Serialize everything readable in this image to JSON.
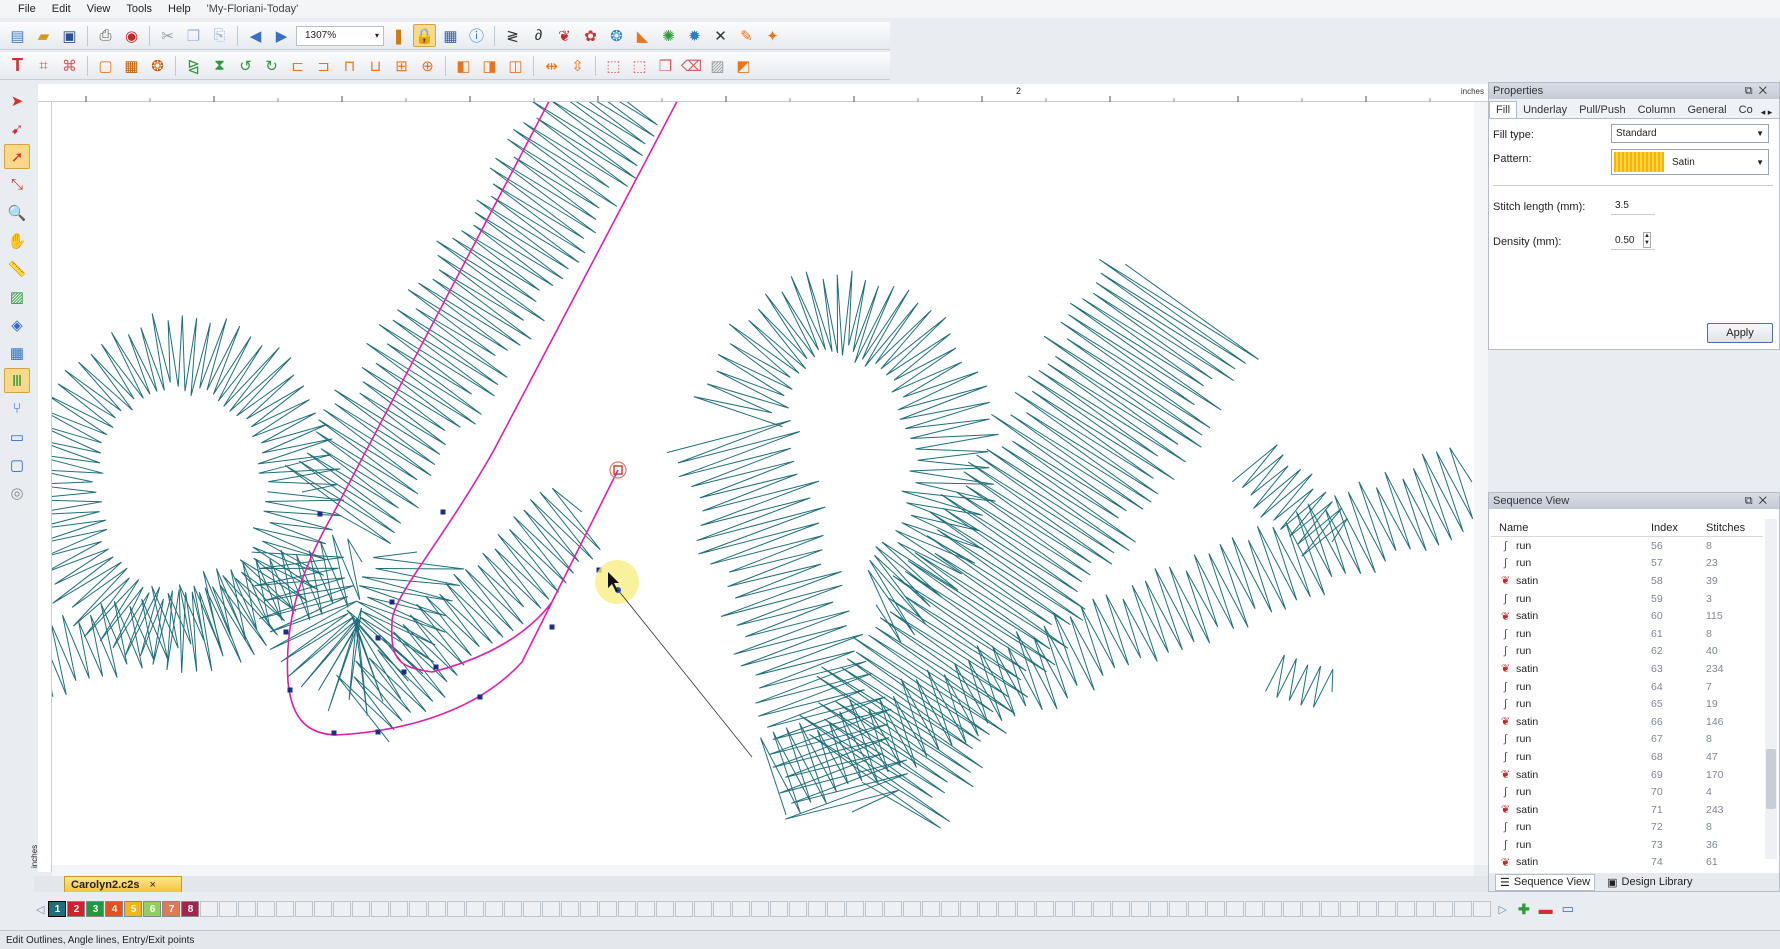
{
  "menu": {
    "items": [
      "File",
      "Edit",
      "View",
      "Tools",
      "Help"
    ],
    "title": "'My-Floriani-Today'"
  },
  "toolbar": {
    "zoom_value": "1307%"
  },
  "ruler": {
    "unit_top": "inches",
    "unit_left": "inches",
    "label_2": "2"
  },
  "document": {
    "tab_name": "Carolyn2.c2s",
    "close_symbol": "×"
  },
  "properties": {
    "title": "Properties",
    "tabs": [
      "Fill",
      "Underlay",
      "Pull/Push",
      "Column",
      "General",
      "Co"
    ],
    "fill_type_label": "Fill type:",
    "fill_type_value": "Standard",
    "pattern_label": "Pattern:",
    "pattern_value": "Satin",
    "stitch_length_label": "Stitch length (mm):",
    "stitch_length_value": "3.5",
    "density_label": "Density (mm):",
    "density_value": "0.50",
    "apply_label": "Apply"
  },
  "sequence": {
    "title": "Sequence View",
    "headers": [
      "Name",
      "Index",
      "Stitches"
    ],
    "rows": [
      {
        "name": "run",
        "index": "56",
        "stitches": "8"
      },
      {
        "name": "run",
        "index": "57",
        "stitches": "23"
      },
      {
        "name": "satin",
        "index": "58",
        "stitches": "39"
      },
      {
        "name": "run",
        "index": "59",
        "stitches": "3"
      },
      {
        "name": "satin",
        "index": "60",
        "stitches": "115"
      },
      {
        "name": "run",
        "index": "61",
        "stitches": "8"
      },
      {
        "name": "run",
        "index": "62",
        "stitches": "40"
      },
      {
        "name": "satin",
        "index": "63",
        "stitches": "234"
      },
      {
        "name": "run",
        "index": "64",
        "stitches": "7"
      },
      {
        "name": "run",
        "index": "65",
        "stitches": "19"
      },
      {
        "name": "satin",
        "index": "66",
        "stitches": "146"
      },
      {
        "name": "run",
        "index": "67",
        "stitches": "8"
      },
      {
        "name": "run",
        "index": "68",
        "stitches": "47"
      },
      {
        "name": "satin",
        "index": "69",
        "stitches": "170"
      },
      {
        "name": "run",
        "index": "70",
        "stitches": "4"
      },
      {
        "name": "satin",
        "index": "71",
        "stitches": "243"
      },
      {
        "name": "run",
        "index": "72",
        "stitches": "8"
      },
      {
        "name": "run",
        "index": "73",
        "stitches": "36"
      },
      {
        "name": "satin",
        "index": "74",
        "stitches": "61"
      }
    ],
    "bottom_tabs": [
      "Sequence View",
      "Design Library"
    ]
  },
  "colors": [
    {
      "num": "1",
      "hex": "#1f6f7a"
    },
    {
      "num": "2",
      "hex": "#d0202a"
    },
    {
      "num": "3",
      "hex": "#1f9a3a"
    },
    {
      "num": "4",
      "hex": "#e5501f"
    },
    {
      "num": "5",
      "hex": "#f2b51b"
    },
    {
      "num": "6",
      "hex": "#8fd15a"
    },
    {
      "num": "7",
      "hex": "#e07a52"
    },
    {
      "num": "8",
      "hex": "#a4234f"
    }
  ],
  "status": {
    "text": "Edit Outlines, Angle lines, Entry/Exit points"
  },
  "accent": {
    "stitch_color": "#1f6f7a",
    "outline_color": "#e020a8",
    "active_tool": "#f8d98a"
  }
}
